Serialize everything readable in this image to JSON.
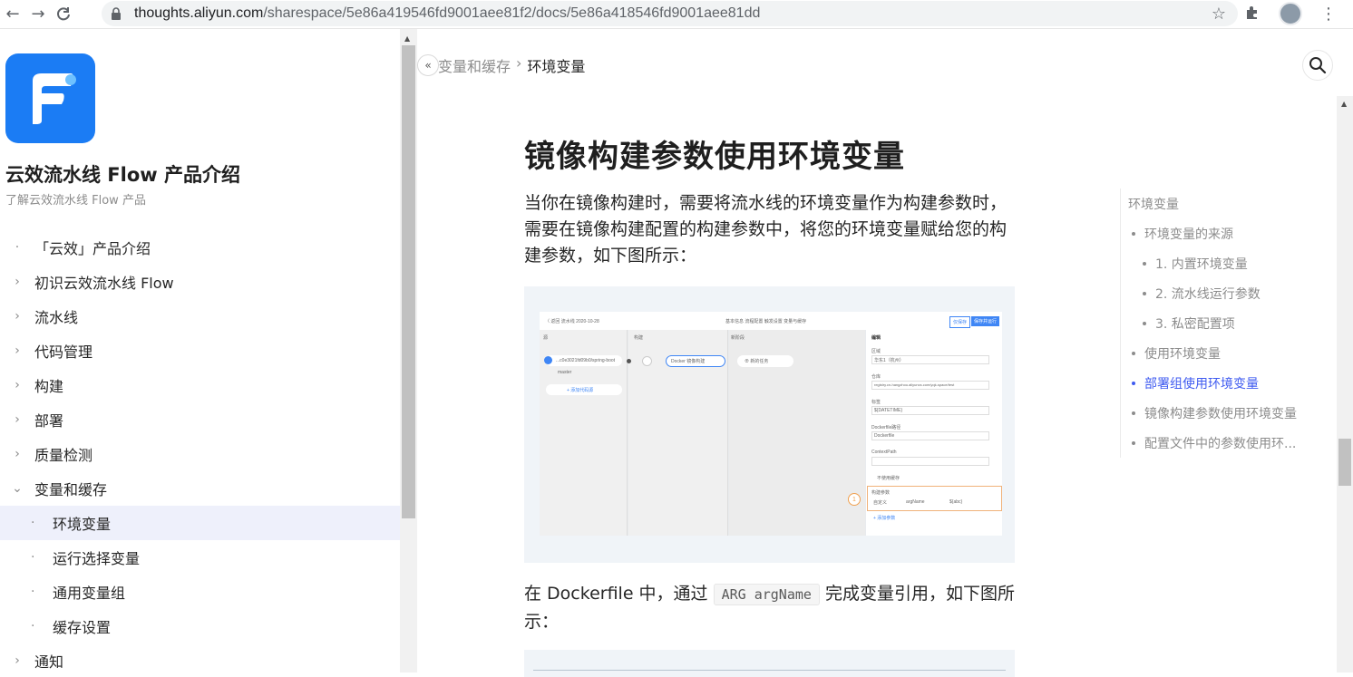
{
  "browser": {
    "back_icon": "←",
    "forward_icon": "→",
    "reload_icon": "C",
    "url_host": "thoughts.aliyun.com",
    "url_path": "/sharespace/5e86a419546fd9001aee81f2/docs/5e86a418546fd9001aee81dd",
    "star_icon": "☆",
    "extensions_icon": "✱",
    "menu_icon": "⋮"
  },
  "sidebar": {
    "product_title": "云效流水线 Flow 产品介绍",
    "product_subtitle": "了解云效流水线 Flow 产品",
    "items": [
      {
        "marker": "·",
        "label": "「云效」产品介绍"
      },
      {
        "marker": "›",
        "label": "初识云效流水线 Flow"
      },
      {
        "marker": "›",
        "label": "流水线"
      },
      {
        "marker": "›",
        "label": "代码管理"
      },
      {
        "marker": "›",
        "label": "构建"
      },
      {
        "marker": "›",
        "label": "部署"
      },
      {
        "marker": "›",
        "label": "质量检测"
      },
      {
        "marker": "⌄",
        "label": "变量和缓存"
      },
      {
        "marker": "·",
        "label": "环境变量"
      },
      {
        "marker": "·",
        "label": "运行选择变量"
      },
      {
        "marker": "·",
        "label": "通用变量组"
      },
      {
        "marker": "·",
        "label": "缓存设置"
      },
      {
        "marker": "›",
        "label": "通知"
      }
    ]
  },
  "main": {
    "collapse_icon": "«",
    "breadcrumb": {
      "parent": "变量和缓存",
      "separator": "›",
      "current": "环境变量"
    },
    "heading": "镜像构建参数使用环境变量",
    "paragraph1": "当你在镜像构建时，需要将流水线的环境变量作为构建参数时，需要在镜像构建配置的构建参数中，将您的环境变量赋给您的构建参数，如下图所示：",
    "paragraph2_before": "在 Dockerfile 中，通过 ",
    "paragraph2_code": "ARG argName",
    "paragraph2_after": " 完成变量引用，如下图所示："
  },
  "toc": {
    "title": "环境变量",
    "items": [
      {
        "label": "环境变量的来源",
        "level": 1,
        "active": false
      },
      {
        "label": "1. 内置环境变量",
        "level": 2,
        "active": false
      },
      {
        "label": "2. 流水线运行参数",
        "level": 2,
        "active": false
      },
      {
        "label": "3. 私密配置项",
        "level": 2,
        "active": false
      },
      {
        "label": "使用环境变量",
        "level": 1,
        "active": false
      },
      {
        "label": "部署组使用环境变量",
        "level": 1,
        "active": true
      },
      {
        "label": "镜像构建参数使用环境变量",
        "level": 1,
        "active": false
      },
      {
        "label": "配置文件中的参数使用环...",
        "level": 1,
        "active": false
      }
    ]
  },
  "embedded_screenshot": {
    "top_left": "〈 返回    流水线 2020-10-28",
    "tabs": "基本信息   流程配置   触发设置   变量与缓存",
    "btn_save": "仅保存",
    "btn_save_run": "保存并运行",
    "col1": "源",
    "col2": "构建",
    "col3": "新阶段",
    "source_node": "...c0e3021fd09b0/spring-boot",
    "branch": "master",
    "add_source": "+ 添加代码源",
    "build_node": "Docker 镜像构建",
    "new_task": "⊕ 新的任务",
    "panel_title": "编辑",
    "f_region": "区域",
    "f_region_val": "华东1（杭州）",
    "f_repo": "仓库",
    "f_repo_val": "registry.cn-hangzhou.aliyuncs.com/yqk-space/test",
    "f_tag": "标签",
    "f_tag_val": "${DATETIME}",
    "f_dockerfile": "Dockerfile路径",
    "f_dockerfile_val": "Dockerfile",
    "f_context": "ContextPath",
    "f_cache": "不使用缓存",
    "f_args": "构建参数",
    "f_arg_type": "自定义",
    "f_arg_name": "argName",
    "f_arg_val": "${abc}",
    "f_add_param": "+ 添加参数",
    "callout": "1"
  },
  "colors": {
    "accent": "#3f5bf0",
    "logo": "#1b7cf4",
    "active_bg": "#eef0fb"
  }
}
